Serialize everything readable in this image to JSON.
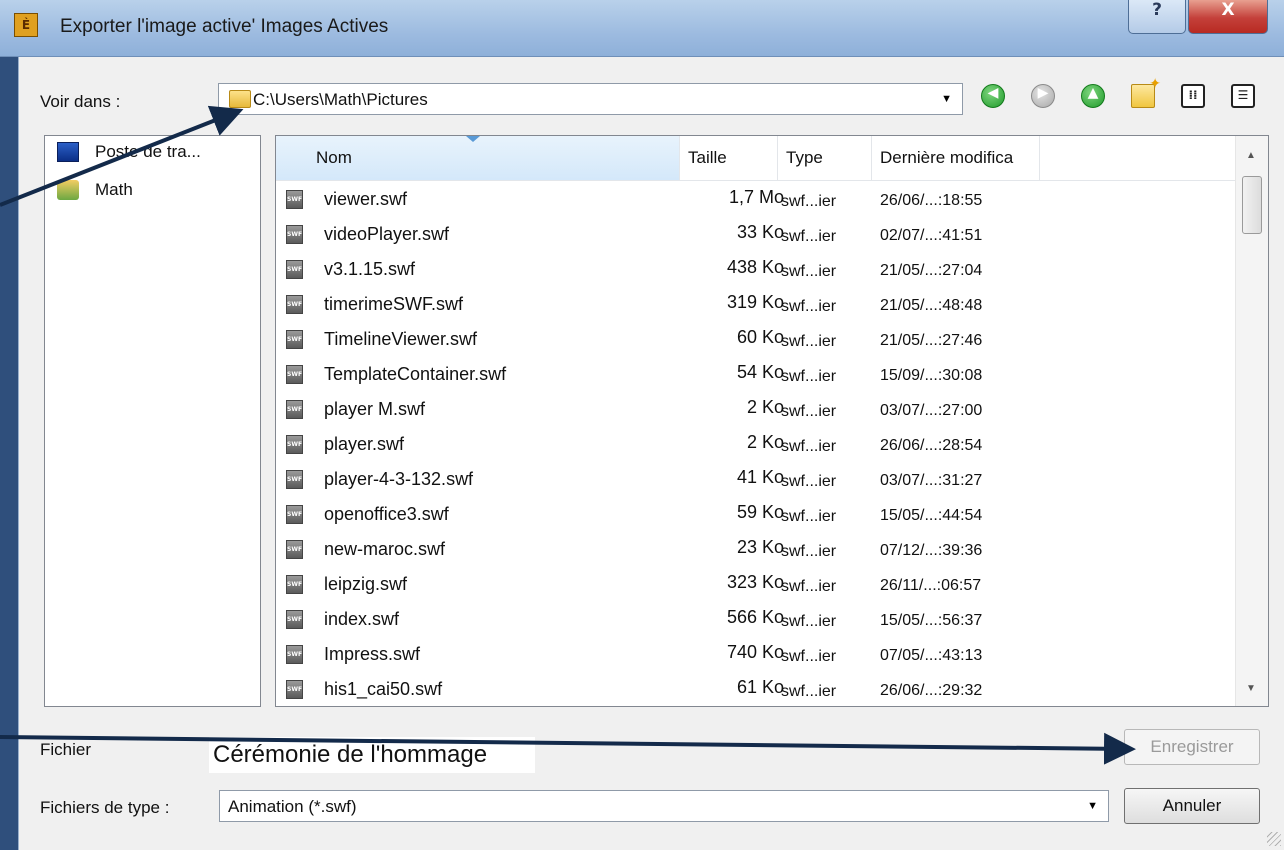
{
  "window": {
    "title": "Exporter l'image active' Images Actives",
    "help_label": "?",
    "close_label": "X"
  },
  "toolbar": {
    "look_in_label": "Voir dans :",
    "look_in_path": "C:\\Users\\Math\\Pictures",
    "icons": [
      "back-icon",
      "forward-icon",
      "up-folder-icon",
      "new-folder-icon",
      "list-view-icon",
      "details-view-icon"
    ]
  },
  "places": [
    {
      "label": "Poste de tra...",
      "icon": "computer-icon"
    },
    {
      "label": "Math",
      "icon": "user-folder-icon"
    }
  ],
  "columns": {
    "name": "Nom",
    "size": "Taille",
    "type": "Type",
    "modified": "Dernière modifica"
  },
  "files": [
    {
      "name": "viewer.swf",
      "size": "1,7 Mo",
      "type": "swf...ier",
      "modified": "26/06/...:18:55"
    },
    {
      "name": "videoPlayer.swf",
      "size": "33 Ko",
      "type": "swf...ier",
      "modified": "02/07/...:41:51"
    },
    {
      "name": "v3.1.15.swf",
      "size": "438 Ko",
      "type": "swf...ier",
      "modified": "21/05/...:27:04"
    },
    {
      "name": "timerimeSWF.swf",
      "size": "319 Ko",
      "type": "swf...ier",
      "modified": "21/05/...:48:48"
    },
    {
      "name": "TimelineViewer.swf",
      "size": "60 Ko",
      "type": "swf...ier",
      "modified": "21/05/...:27:46"
    },
    {
      "name": "TemplateContainer.swf",
      "size": "54 Ko",
      "type": "swf...ier",
      "modified": "15/09/...:30:08"
    },
    {
      "name": "player M.swf",
      "size": "2 Ko",
      "type": "swf...ier",
      "modified": "03/07/...:27:00"
    },
    {
      "name": "player.swf",
      "size": "2 Ko",
      "type": "swf...ier",
      "modified": "26/06/...:28:54"
    },
    {
      "name": "player-4-3-132.swf",
      "size": "41 Ko",
      "type": "swf...ier",
      "modified": "03/07/...:31:27"
    },
    {
      "name": "openoffice3.swf",
      "size": "59 Ko",
      "type": "swf...ier",
      "modified": "15/05/...:44:54"
    },
    {
      "name": "new-maroc.swf",
      "size": "23 Ko",
      "type": "swf...ier",
      "modified": "07/12/...:39:36"
    },
    {
      "name": "leipzig.swf",
      "size": "323 Ko",
      "type": "swf...ier",
      "modified": "26/11/...:06:57"
    },
    {
      "name": "index.swf",
      "size": "566 Ko",
      "type": "swf...ier",
      "modified": "15/05/...:56:37"
    },
    {
      "name": "Impress.swf",
      "size": "740 Ko",
      "type": "swf...ier",
      "modified": "07/05/...:43:13"
    },
    {
      "name": "his1_cai50.swf",
      "size": "61 Ko",
      "type": "swf...ier",
      "modified": "26/06/...:29:32"
    }
  ],
  "file_icon_text": "SWF",
  "footer": {
    "filename_label": "Fichier",
    "filename_value": "Cérémonie de l'hommage",
    "save_label": "Enregistrer",
    "filetype_label": "Fichiers de type :",
    "filetype_value": "Animation (*.swf)",
    "cancel_label": "Annuler"
  },
  "colors": {
    "background": "#2f4f7c",
    "annotation_arrow": "#132a4a",
    "close_button": "#c4403a"
  }
}
